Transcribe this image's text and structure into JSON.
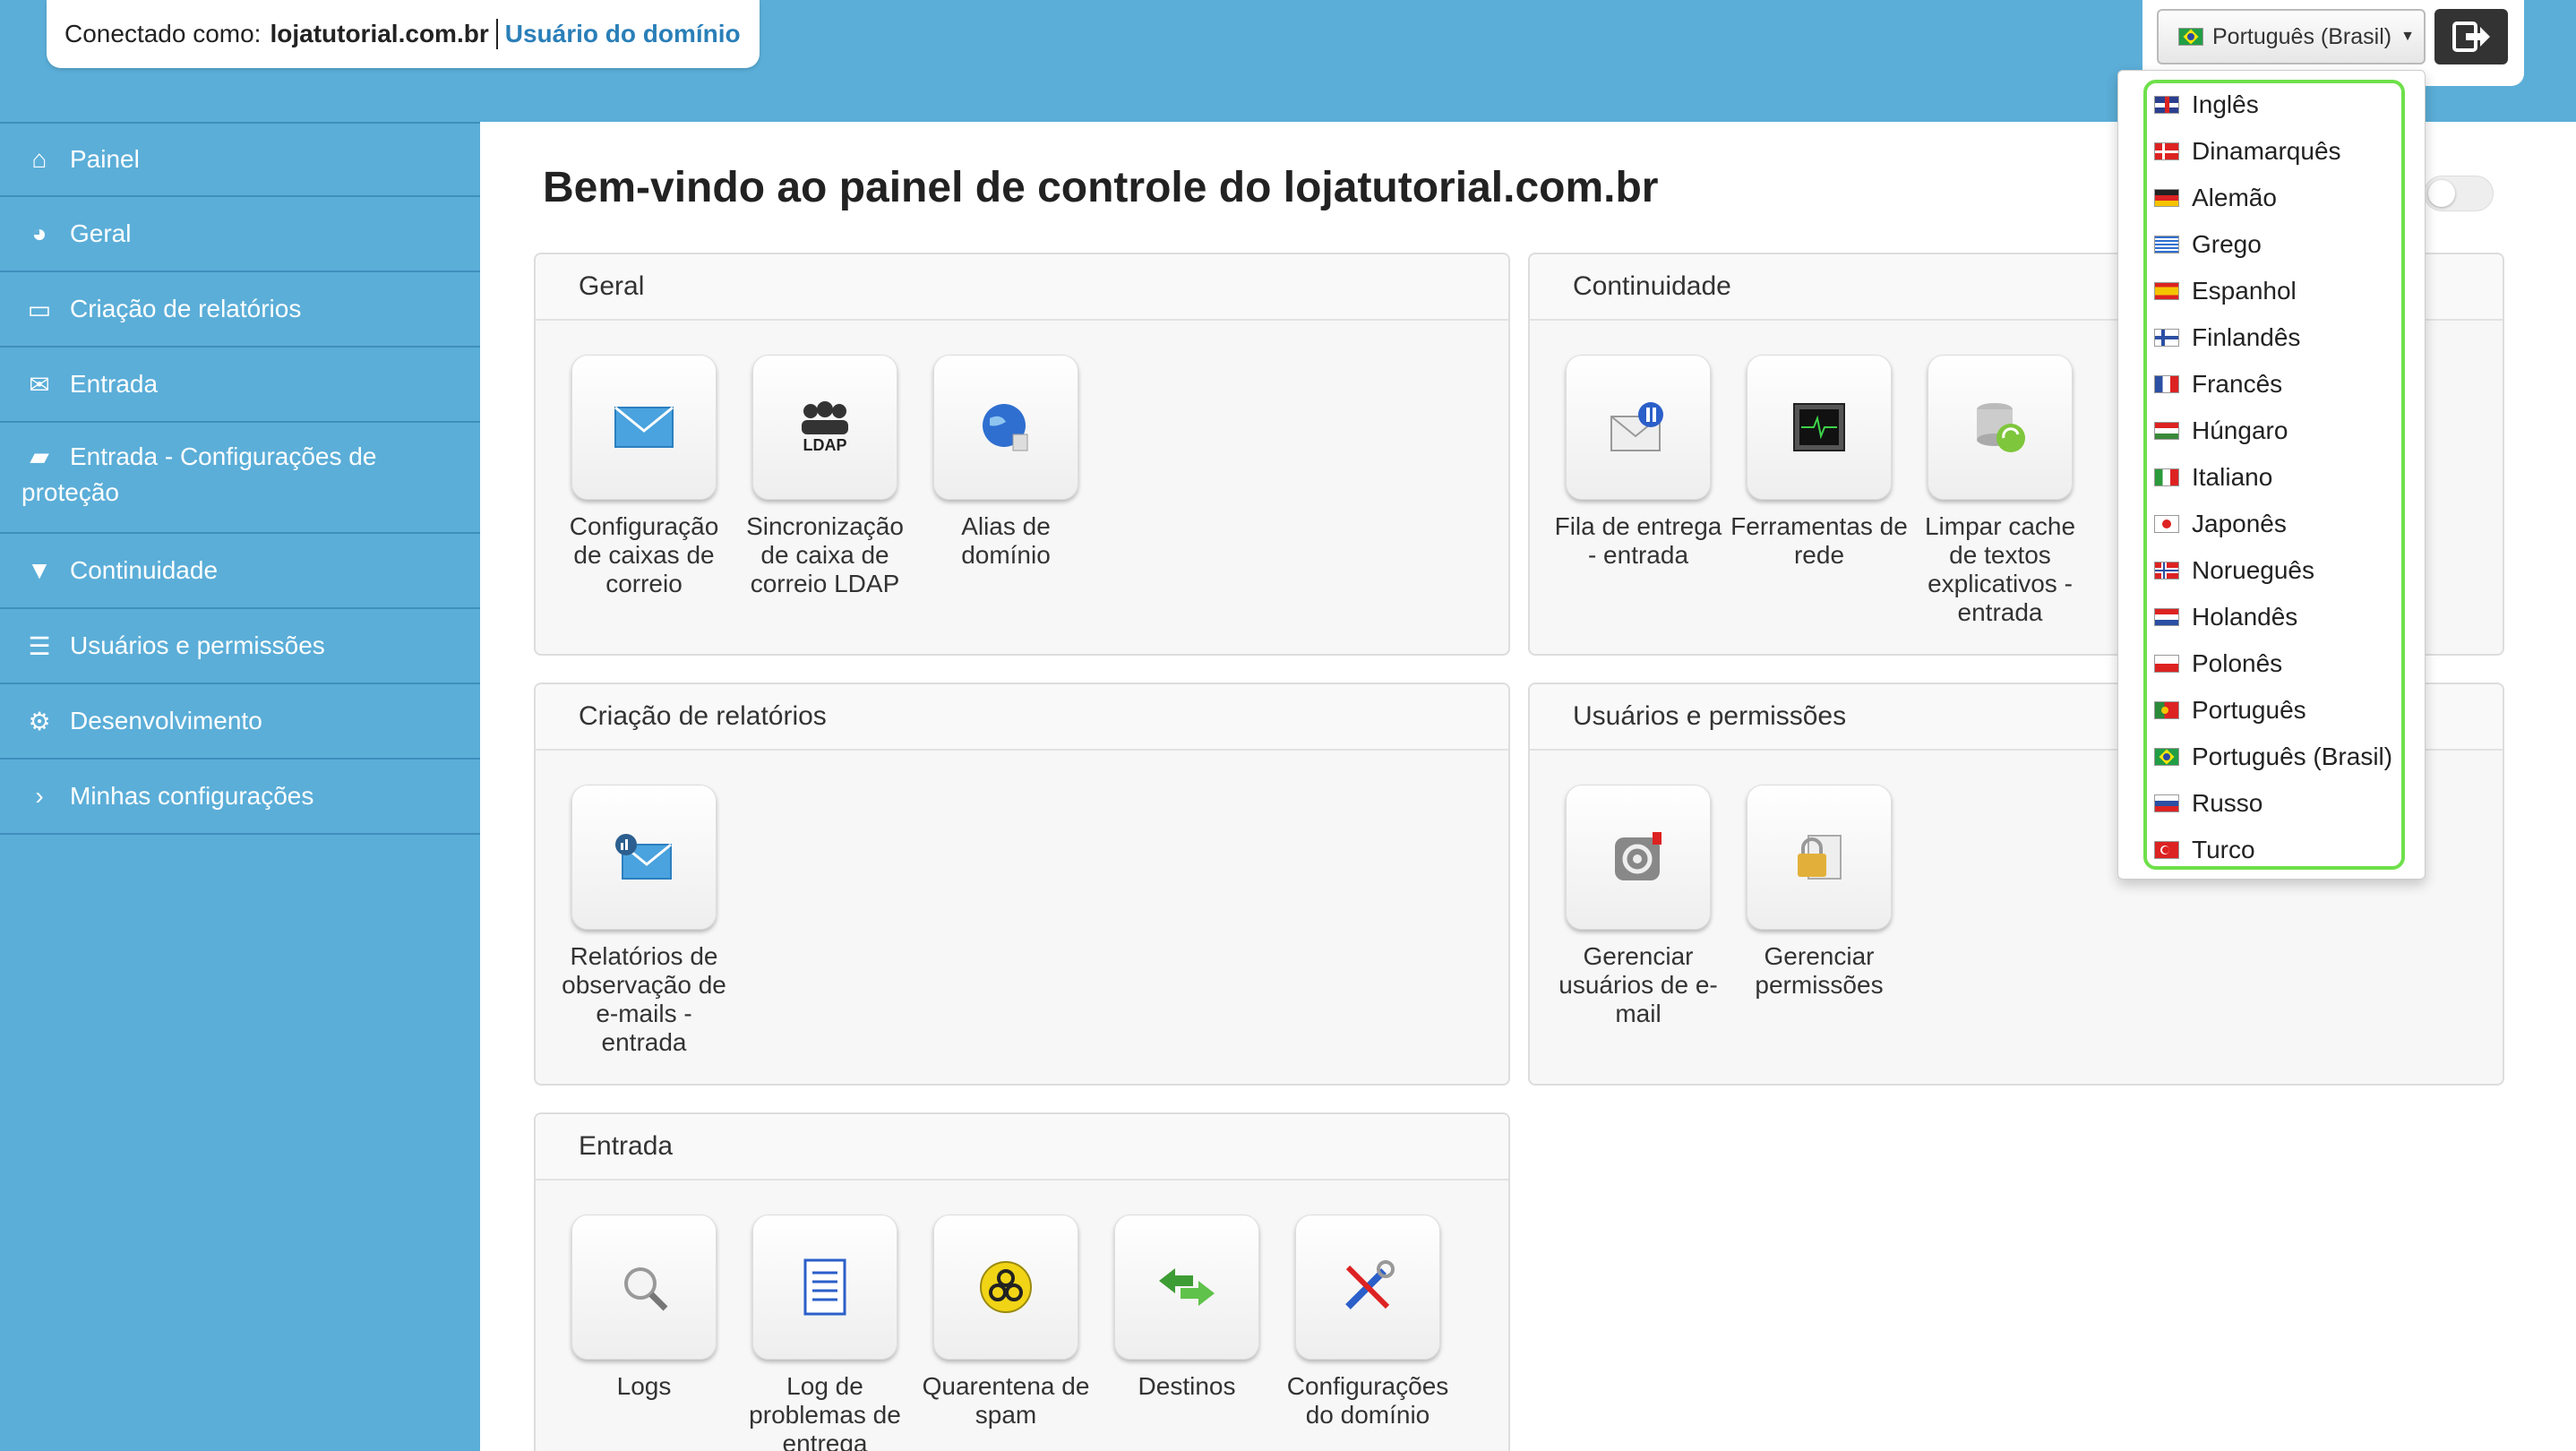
{
  "header": {
    "connected_label": "Conectado como:",
    "domain": "lojatutorial.com.br",
    "role": "Usuário do domínio",
    "language_button": "Português (Brasil)"
  },
  "sidebar": {
    "items": [
      {
        "label": "Painel",
        "icon": "home-icon"
      },
      {
        "label": "Geral",
        "icon": "globe-icon"
      },
      {
        "label": "Criação de relatórios",
        "icon": "inbox-icon"
      },
      {
        "label": "Entrada",
        "icon": "envelope-icon"
      },
      {
        "label": "Entrada - Configurações de proteção",
        "icon": "folder-open-icon"
      },
      {
        "label": "Continuidade",
        "icon": "filter-icon"
      },
      {
        "label": "Usuários e permissões",
        "icon": "list-icon"
      },
      {
        "label": "Desenvolvimento",
        "icon": "gear-icon"
      },
      {
        "label": "Minhas configurações",
        "icon": "chevron-right-icon"
      }
    ]
  },
  "main": {
    "title": "Bem-vindo ao painel de controle do lojatutorial.com.br",
    "panels": {
      "geral": {
        "title": "Geral",
        "tiles": [
          "Configuração de caixas de correio",
          "Sincronização de caixa de correio LDAP",
          "Alias de domínio"
        ]
      },
      "continuidade": {
        "title": "Continuidade",
        "tiles": [
          "Fila de entrega - entrada",
          "Ferramentas de rede",
          "Limpar cache de textos explicativos - entrada"
        ]
      },
      "relatorios": {
        "title": "Criação de relatórios",
        "tiles": [
          "Relatórios de observação de e-mails - entrada"
        ]
      },
      "usuarios": {
        "title": "Usuários e permissões",
        "tiles": [
          "Gerenciar usuários de e-mail",
          "Gerenciar permissões"
        ]
      },
      "entrada": {
        "title": "Entrada",
        "tiles": [
          "Logs",
          "Log de problemas de entrega",
          "Quarentena de spam",
          "Destinos",
          "Configurações do domínio"
        ]
      }
    },
    "ldap_icon_text": "LDAP"
  },
  "languages": [
    "Inglês",
    "Dinamarquês",
    "Alemão",
    "Grego",
    "Espanhol",
    "Finlandês",
    "Francês",
    "Húngaro",
    "Italiano",
    "Japonês",
    "Norueguês",
    "Holandês",
    "Polonês",
    "Português",
    "Português (Brasil)",
    "Russo",
    "Turco"
  ]
}
